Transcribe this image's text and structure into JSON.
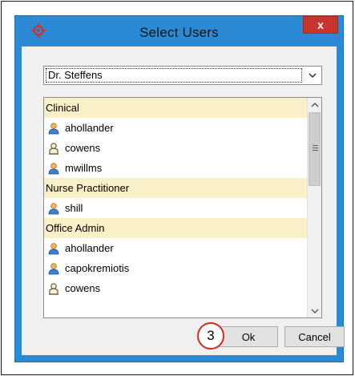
{
  "window": {
    "title": "Select Users",
    "close_glyph": "x",
    "app_icon": "target-crosshair-icon",
    "accent_color": "#2c8ad4",
    "close_color": "#c7352d"
  },
  "provider_select": {
    "value": "Dr. Steffens"
  },
  "user_list": {
    "group_bg_color": "#faf0c8",
    "items": [
      {
        "type": "group",
        "label": "Clinical"
      },
      {
        "type": "user",
        "label": "ahollander",
        "icon": "user-icon"
      },
      {
        "type": "user",
        "label": "cowens",
        "icon": "user-outline-icon"
      },
      {
        "type": "user",
        "label": "mwillms",
        "icon": "user-icon"
      },
      {
        "type": "group",
        "label": "Nurse Practitioner"
      },
      {
        "type": "user",
        "label": "shill",
        "icon": "user-icon"
      },
      {
        "type": "group",
        "label": "Office Admin"
      },
      {
        "type": "user",
        "label": "ahollander",
        "icon": "user-icon"
      },
      {
        "type": "user",
        "label": "capokremiotis",
        "icon": "user-icon"
      },
      {
        "type": "user",
        "label": "cowens",
        "icon": "user-outline-icon"
      }
    ]
  },
  "buttons": {
    "ok_label": "Ok",
    "cancel_label": "Cancel"
  },
  "annotation": {
    "step_number": "3"
  }
}
